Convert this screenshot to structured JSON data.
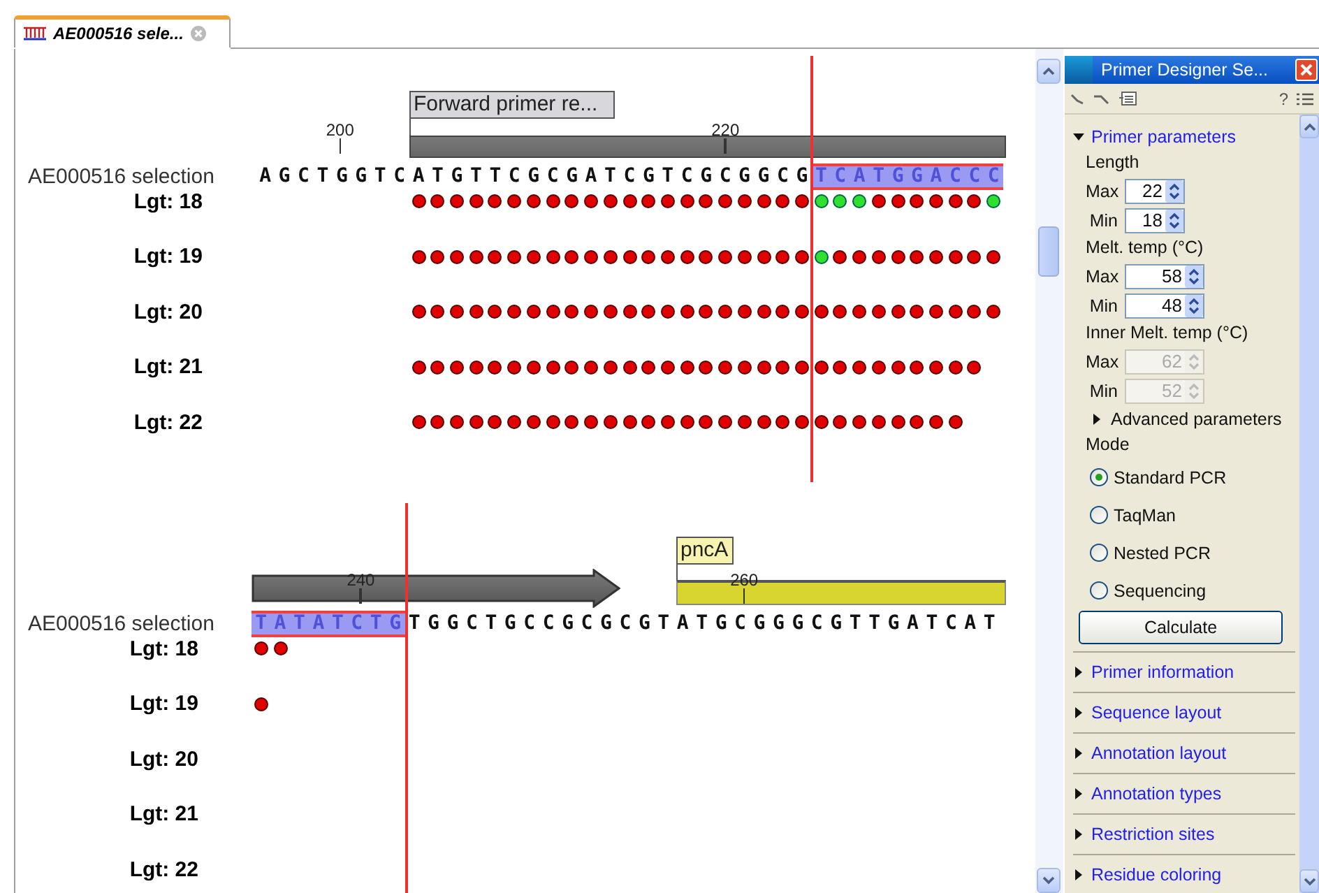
{
  "tab": {
    "title": "AE000516 sele...",
    "selected": true
  },
  "blocks": [
    {
      "name": "AE000516 selection",
      "ruler": [
        "200",
        "220"
      ],
      "annotations": [
        {
          "kind": "region",
          "label": "Forward primer re..."
        }
      ],
      "sequence": [
        {
          "text": "AGCTGGTCATGTTCGCGATCGTCGCGGCG",
          "selected": false
        },
        {
          "text": "TCATGGACCC",
          "selected": true
        }
      ],
      "rows": [
        {
          "label": "Lgt: 18",
          "dots": [
            {
              "passed": false
            },
            {
              "passed": false
            },
            {
              "passed": false
            },
            {
              "passed": false
            },
            {
              "passed": false
            },
            {
              "passed": false
            },
            {
              "passed": false
            },
            {
              "passed": false
            },
            {
              "passed": false
            },
            {
              "passed": false
            },
            {
              "passed": false
            },
            {
              "passed": false
            },
            {
              "passed": false
            },
            {
              "passed": false
            },
            {
              "passed": false
            },
            {
              "passed": false
            },
            {
              "passed": false
            },
            {
              "passed": false
            },
            {
              "passed": false
            },
            {
              "passed": false
            },
            {
              "passed": false
            },
            {
              "passed": true
            },
            {
              "passed": true
            },
            {
              "passed": true
            },
            {
              "passed": false
            },
            {
              "passed": false
            },
            {
              "passed": false
            },
            {
              "passed": false
            },
            {
              "passed": false
            },
            {
              "passed": false
            },
            {
              "passed": true
            }
          ]
        },
        {
          "label": "Lgt: 19",
          "dots": [
            {
              "passed": false
            },
            {
              "passed": false
            },
            {
              "passed": false
            },
            {
              "passed": false
            },
            {
              "passed": false
            },
            {
              "passed": false
            },
            {
              "passed": false
            },
            {
              "passed": false
            },
            {
              "passed": false
            },
            {
              "passed": false
            },
            {
              "passed": false
            },
            {
              "passed": false
            },
            {
              "passed": false
            },
            {
              "passed": false
            },
            {
              "passed": false
            },
            {
              "passed": false
            },
            {
              "passed": false
            },
            {
              "passed": false
            },
            {
              "passed": false
            },
            {
              "passed": false
            },
            {
              "passed": false
            },
            {
              "passed": true
            },
            {
              "passed": false
            },
            {
              "passed": false
            },
            {
              "passed": false
            },
            {
              "passed": false
            },
            {
              "passed": false
            },
            {
              "passed": false
            },
            {
              "passed": false
            },
            {
              "passed": false
            },
            {
              "passed": false
            }
          ]
        },
        {
          "label": "Lgt: 20",
          "dots": [
            {
              "passed": false
            },
            {
              "passed": false
            },
            {
              "passed": false
            },
            {
              "passed": false
            },
            {
              "passed": false
            },
            {
              "passed": false
            },
            {
              "passed": false
            },
            {
              "passed": false
            },
            {
              "passed": false
            },
            {
              "passed": false
            },
            {
              "passed": false
            },
            {
              "passed": false
            },
            {
              "passed": false
            },
            {
              "passed": false
            },
            {
              "passed": false
            },
            {
              "passed": false
            },
            {
              "passed": false
            },
            {
              "passed": false
            },
            {
              "passed": false
            },
            {
              "passed": false
            },
            {
              "passed": false
            },
            {
              "passed": false
            },
            {
              "passed": false
            },
            {
              "passed": false
            },
            {
              "passed": false
            },
            {
              "passed": false
            },
            {
              "passed": false
            },
            {
              "passed": false
            },
            {
              "passed": false
            },
            {
              "passed": false
            },
            {
              "passed": false
            }
          ]
        },
        {
          "label": "Lgt: 21",
          "dots": [
            {
              "passed": false
            },
            {
              "passed": false
            },
            {
              "passed": false
            },
            {
              "passed": false
            },
            {
              "passed": false
            },
            {
              "passed": false
            },
            {
              "passed": false
            },
            {
              "passed": false
            },
            {
              "passed": false
            },
            {
              "passed": false
            },
            {
              "passed": false
            },
            {
              "passed": false
            },
            {
              "passed": false
            },
            {
              "passed": false
            },
            {
              "passed": false
            },
            {
              "passed": false
            },
            {
              "passed": false
            },
            {
              "passed": false
            },
            {
              "passed": false
            },
            {
              "passed": false
            },
            {
              "passed": false
            },
            {
              "passed": false
            },
            {
              "passed": false
            },
            {
              "passed": false
            },
            {
              "passed": false
            },
            {
              "passed": false
            },
            {
              "passed": false
            },
            {
              "passed": false
            },
            {
              "passed": false
            },
            {
              "passed": false
            }
          ]
        },
        {
          "label": "Lgt: 22",
          "dots": [
            {
              "passed": false
            },
            {
              "passed": false
            },
            {
              "passed": false
            },
            {
              "passed": false
            },
            {
              "passed": false
            },
            {
              "passed": false
            },
            {
              "passed": false
            },
            {
              "passed": false
            },
            {
              "passed": false
            },
            {
              "passed": false
            },
            {
              "passed": false
            },
            {
              "passed": false
            },
            {
              "passed": false
            },
            {
              "passed": false
            },
            {
              "passed": false
            },
            {
              "passed": false
            },
            {
              "passed": false
            },
            {
              "passed": false
            },
            {
              "passed": false
            },
            {
              "passed": false
            },
            {
              "passed": false
            },
            {
              "passed": false
            },
            {
              "passed": false
            },
            {
              "passed": false
            },
            {
              "passed": false
            },
            {
              "passed": false
            },
            {
              "passed": false
            },
            {
              "passed": false
            },
            {
              "passed": false
            }
          ]
        }
      ]
    },
    {
      "name": "AE000516 selection",
      "ruler": [
        "240",
        "260"
      ],
      "annotations": [
        {
          "kind": "arrow"
        },
        {
          "kind": "gene",
          "label": "pncA"
        }
      ],
      "sequence": [
        {
          "text": "TATATCTG",
          "selected": true
        },
        {
          "text": "TGGCTGCCGCGCGTATGCGGGCGTTGATCAT",
          "selected": false
        }
      ],
      "rows": [
        {
          "label": "Lgt: 18",
          "dots": [
            {
              "passed": false
            },
            {
              "passed": false
            }
          ]
        },
        {
          "label": "Lgt: 19",
          "dots": [
            {
              "passed": false
            }
          ]
        },
        {
          "label": "Lgt: 20",
          "dots": []
        },
        {
          "label": "Lgt: 21",
          "dots": []
        },
        {
          "label": "Lgt: 22",
          "dots": []
        }
      ]
    }
  ],
  "panel": {
    "title": "Primer Designer Se...",
    "help": "?",
    "parameters": {
      "label": "Primer parameters",
      "expanded": true,
      "groups": [
        {
          "label": "Length",
          "kind": "narrow",
          "disabled": false,
          "fields": [
            {
              "label": "Max",
              "value": "22"
            },
            {
              "label": "Min",
              "value": "18"
            }
          ]
        },
        {
          "label": "Melt. temp (°C)",
          "kind": "wide",
          "disabled": false,
          "fields": [
            {
              "label": "Max",
              "value": "58"
            },
            {
              "label": "Min",
              "value": "48"
            }
          ]
        },
        {
          "label": "Inner Melt. temp (°C)",
          "kind": "wide",
          "disabled": true,
          "fields": [
            {
              "label": "Max",
              "value": "62"
            },
            {
              "label": "Min",
              "value": "52"
            }
          ]
        }
      ],
      "advanced": {
        "label": "Advanced parameters",
        "expanded": false
      },
      "mode": {
        "label": "Mode",
        "options": [
          {
            "label": "Standard PCR",
            "selected": true
          },
          {
            "label": "TaqMan",
            "selected": false
          },
          {
            "label": "Nested PCR",
            "selected": false
          },
          {
            "label": "Sequencing",
            "selected": false
          }
        ]
      },
      "button": "Calculate"
    },
    "sections": [
      {
        "label": "Primer information",
        "expanded": false
      },
      {
        "label": "Sequence layout",
        "expanded": false
      },
      {
        "label": "Annotation layout",
        "expanded": false
      },
      {
        "label": "Annotation types",
        "expanded": false
      },
      {
        "label": "Restriction sites",
        "expanded": false
      },
      {
        "label": "Residue coloring",
        "expanded": false
      }
    ]
  }
}
